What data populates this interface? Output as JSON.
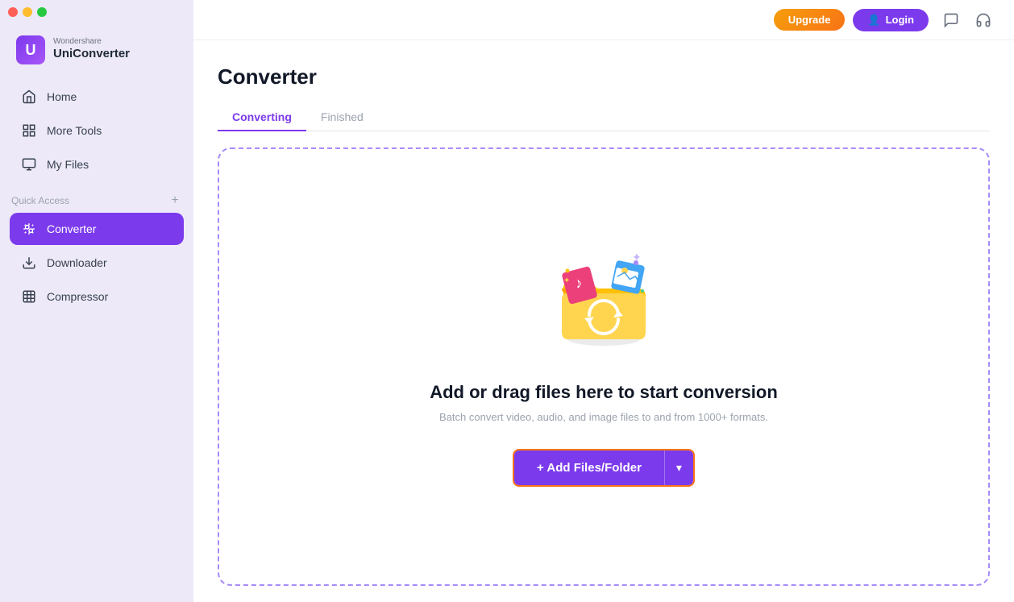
{
  "app": {
    "brand": "Wondershare",
    "name": "UniConverter"
  },
  "titlebar": {
    "close": "close",
    "minimize": "minimize",
    "maximize": "maximize"
  },
  "topbar": {
    "upgrade_label": "Upgrade",
    "login_label": "Login",
    "login_icon": "👤",
    "message_icon": "💬",
    "headset_icon": "🎧"
  },
  "sidebar": {
    "nav_items": [
      {
        "id": "home",
        "label": "Home",
        "icon": "⌂",
        "active": false
      },
      {
        "id": "more-tools",
        "label": "More Tools",
        "icon": "⊞",
        "active": false
      },
      {
        "id": "my-files",
        "label": "My Files",
        "icon": "▤",
        "active": false
      }
    ],
    "quick_access_label": "Quick Access",
    "quick_access_add": "+",
    "quick_access_items": [
      {
        "id": "converter",
        "label": "Converter",
        "icon": "⇄",
        "active": true
      },
      {
        "id": "downloader",
        "label": "Downloader",
        "icon": "⬇",
        "active": false
      },
      {
        "id": "compressor",
        "label": "Compressor",
        "icon": "⊟",
        "active": false
      }
    ]
  },
  "main": {
    "page_title": "Converter",
    "tabs": [
      {
        "id": "converting",
        "label": "Converting",
        "active": true
      },
      {
        "id": "finished",
        "label": "Finished",
        "active": false
      }
    ],
    "dropzone": {
      "title": "Add or drag files here to start conversion",
      "subtitle": "Batch convert video, audio, and image files to and from 1000+ formats.",
      "add_button_label": "+ Add Files/Folder",
      "add_button_arrow": "▾"
    }
  }
}
